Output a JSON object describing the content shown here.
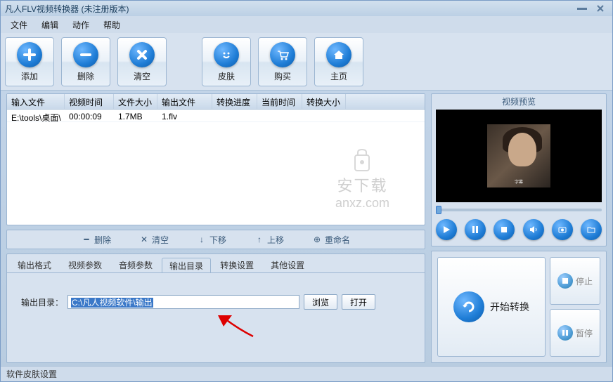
{
  "title": "凡人FLV视频转换器   (未注册版本)",
  "menu": {
    "file": "文件",
    "edit": "编辑",
    "action": "动作",
    "help": "帮助"
  },
  "toolbar": {
    "add": "添加",
    "delete": "删除",
    "clear": "清空",
    "skin": "皮肤",
    "buy": "购买",
    "home": "主页"
  },
  "table": {
    "headers": {
      "input": "输入文件",
      "duration": "视频时间",
      "size": "文件大小",
      "output": "输出文件",
      "progress": "转换进度",
      "current": "当前时间",
      "outsize": "转换大小"
    },
    "rows": [
      {
        "input": "E:\\tools\\桌面\\",
        "duration": "00:00:09",
        "size": "1.7MB",
        "output": "1.flv",
        "progress": "",
        "current": "",
        "outsize": ""
      }
    ]
  },
  "watermark": {
    "text": "安下载",
    "url": "anxz.com"
  },
  "actions": {
    "delete": "删除",
    "clear": "清空",
    "down": "下移",
    "up": "上移",
    "rename": "重命名"
  },
  "tabs": {
    "format": "输出格式",
    "video": "视频参数",
    "audio": "音频参数",
    "outdir": "输出目录",
    "convert": "转换设置",
    "other": "其他设置"
  },
  "outdir": {
    "label": "输出目录：",
    "value": "C:\\凡人视频软件\\输出",
    "browse": "浏览",
    "open": "打开"
  },
  "preview": {
    "title": "视频预览"
  },
  "convert_btn": {
    "start": "开始转换",
    "stop": "停止",
    "pause": "暂停"
  },
  "status": "软件皮肤设置"
}
